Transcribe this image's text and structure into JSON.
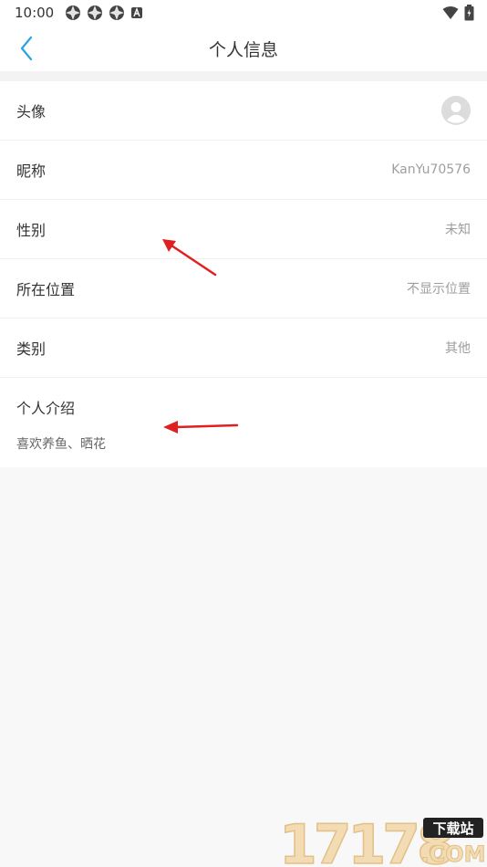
{
  "status_bar": {
    "time": "10:00"
  },
  "app_bar": {
    "title": "个人信息"
  },
  "rows": [
    {
      "label": "头像",
      "value": ""
    },
    {
      "label": "昵称",
      "value": "KanYu70576"
    },
    {
      "label": "性别",
      "value": "未知"
    },
    {
      "label": "所在位置",
      "value": "不显示位置"
    },
    {
      "label": "类别",
      "value": "其他"
    }
  ],
  "bio": {
    "label": "个人介绍",
    "text": "喜欢养鱼、晒花"
  },
  "watermark": {
    "digits": "17178",
    "tag": "下载站",
    "domain": ".COM"
  },
  "colors": {
    "accent": "#29a3e8",
    "arrow": "#e02020",
    "value_text": "#9e9e9e"
  }
}
